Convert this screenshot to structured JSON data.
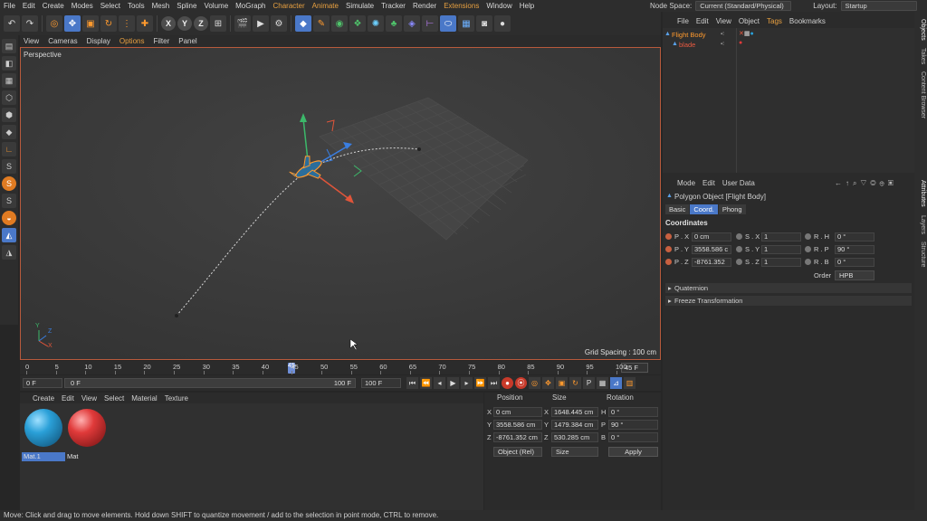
{
  "menubar": {
    "items": [
      "File",
      "Edit",
      "Create",
      "Modes",
      "Select",
      "Tools",
      "Mesh",
      "Spline",
      "Volume",
      "MoGraph",
      "Character",
      "Animate",
      "Simulate",
      "Tracker",
      "Render",
      "Extensions",
      "Window",
      "Help"
    ],
    "node_space_label": "Node Space:",
    "node_space_value": "Current (Standard/Physical)",
    "layout_label": "Layout:",
    "layout_value": "Startup"
  },
  "viewport": {
    "menu": [
      "View",
      "Cameras",
      "Display",
      "Options",
      "Filter",
      "Panel"
    ],
    "view_name": "Perspective",
    "grid_spacing": "Grid Spacing : 100 cm",
    "axis_y": "Y",
    "axis_z": "Z",
    "axis_x": "X"
  },
  "timeline": {
    "ticks": [
      "0",
      "5",
      "10",
      "15",
      "20",
      "25",
      "30",
      "35",
      "40",
      "45",
      "50",
      "55",
      "60",
      "65",
      "70",
      "75",
      "80",
      "85",
      "90",
      "95",
      "100"
    ],
    "current_frame": "45 F",
    "playhead_label": "45"
  },
  "playback": {
    "start_field": "0 F",
    "range_start": "0 F",
    "range_end": "100 F",
    "end_field": "100 F"
  },
  "material_manager": {
    "menu": [
      "Create",
      "Edit",
      "View",
      "Select",
      "Material",
      "Texture"
    ],
    "materials": [
      {
        "name": "Mat.1",
        "color": "#2aa0d8"
      },
      {
        "name": "Mat",
        "color": "#e03a3a"
      }
    ]
  },
  "coordinates": {
    "headers": [
      "Position",
      "Size",
      "Rotation"
    ],
    "rows": [
      {
        "axis": "X",
        "pos": "0 cm",
        "size_axis": "X",
        "size": "1648.445 cm",
        "rot_axis": "H",
        "rot": "0 °"
      },
      {
        "axis": "Y",
        "pos": "3558.586 cm",
        "size_axis": "Y",
        "size": "1479.384 cm",
        "rot_axis": "P",
        "rot": "90 °"
      },
      {
        "axis": "Z",
        "pos": "-8761.352 cm",
        "size_axis": "Z",
        "size": "530.285 cm",
        "rot_axis": "B",
        "rot": "0 °"
      }
    ],
    "mode_dropdown": "Object (Rel)",
    "size_dropdown": "Size",
    "apply_button": "Apply"
  },
  "object_manager": {
    "menu": [
      "File",
      "Edit",
      "View",
      "Object",
      "Tags",
      "Bookmarks"
    ],
    "objects": [
      {
        "name": "Flight Body"
      },
      {
        "name": "blade"
      }
    ]
  },
  "attribute_manager": {
    "menu": [
      "Mode",
      "Edit",
      "User Data"
    ],
    "title": "Polygon Object [Flight Body]",
    "tabs": [
      "Basic",
      "Coord.",
      "Phong"
    ],
    "section": "Coordinates",
    "rows": [
      {
        "p_label": "P . X",
        "p_val": "0 cm",
        "s_label": "S . X",
        "s_val": "1",
        "r_label": "R . H",
        "r_val": "0 °"
      },
      {
        "p_label": "P . Y",
        "p_val": "3558.586 c",
        "s_label": "S . Y",
        "s_val": "1",
        "r_label": "R . P",
        "r_val": "90 °"
      },
      {
        "p_label": "P . Z",
        "p_val": "-8761.352",
        "s_label": "S . Z",
        "s_val": "1",
        "r_label": "R . B",
        "r_val": "0 °"
      }
    ],
    "order_label": "Order",
    "order_value": "HPB",
    "collapsibles": [
      "Quaternion",
      "Freeze Transformation"
    ]
  },
  "right_tabs": [
    "Objects",
    "Takes",
    "Content Browser",
    "Attributes",
    "Layers",
    "Structure"
  ],
  "status": "Move: Click and drag to move elements. Hold down SHIFT to quantize movement / add to the selection in point mode, CTRL to remove."
}
